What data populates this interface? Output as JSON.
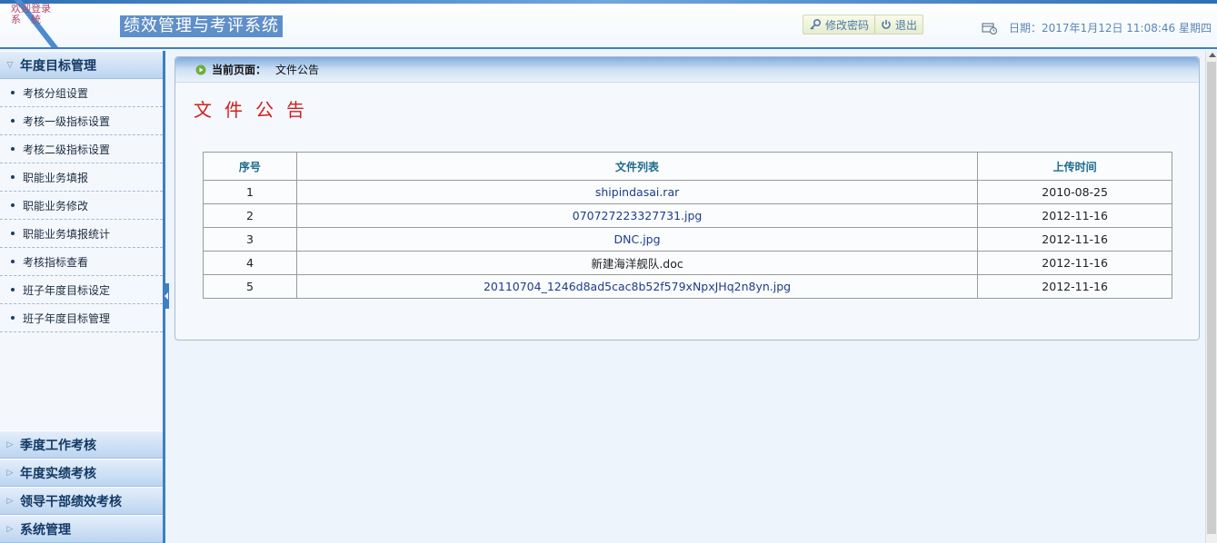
{
  "header": {
    "welcome_line1": "欢迎登录",
    "welcome_line2": "系　统",
    "system_title": "绩效管理与考评系统",
    "change_password_label": "修改密码",
    "logout_label": "退出",
    "date_label": "日期：",
    "date_value": "2017年1月12日  11:08:46 星期四"
  },
  "sidebar": {
    "active_menu": "年度目标管理",
    "items": [
      {
        "label": "考核分组设置"
      },
      {
        "label": "考核一级指标设置"
      },
      {
        "label": "考核二级指标设置"
      },
      {
        "label": "职能业务填报"
      },
      {
        "label": "职能业务修改"
      },
      {
        "label": "职能业务填报统计"
      },
      {
        "label": "考核指标查看"
      },
      {
        "label": "班子年度目标设定"
      },
      {
        "label": "班子年度目标管理"
      }
    ],
    "other_menus": [
      {
        "label": "季度工作考核"
      },
      {
        "label": "年度实绩考核"
      },
      {
        "label": "领导干部绩效考核"
      },
      {
        "label": "系统管理"
      }
    ]
  },
  "main": {
    "breadcrumb_label": "当前页面：",
    "breadcrumb_value": "文件公告",
    "page_heading": "文件公告",
    "table": {
      "headers": {
        "index": "序号",
        "file": "文件列表",
        "time": "上传时间"
      },
      "rows": [
        {
          "index": "1",
          "file": "shipindasai.rar",
          "time": "2010-08-25"
        },
        {
          "index": "2",
          "file": "070727223327731.jpg",
          "time": "2012-11-16"
        },
        {
          "index": "3",
          "file": "DNC.jpg",
          "time": "2012-11-16"
        },
        {
          "index": "4",
          "file": "新建海洋舰队.doc",
          "time": "2012-11-16"
        },
        {
          "index": "5",
          "file": "20110704_1246d8ad5cac8b52f579xNpxJHq2n8yn.jpg",
          "time": "2012-11-16"
        }
      ]
    }
  },
  "colors": {
    "accent": "#3d7fc4",
    "heading_red": "#d41e1e",
    "link_blue": "#1d3d8a"
  }
}
